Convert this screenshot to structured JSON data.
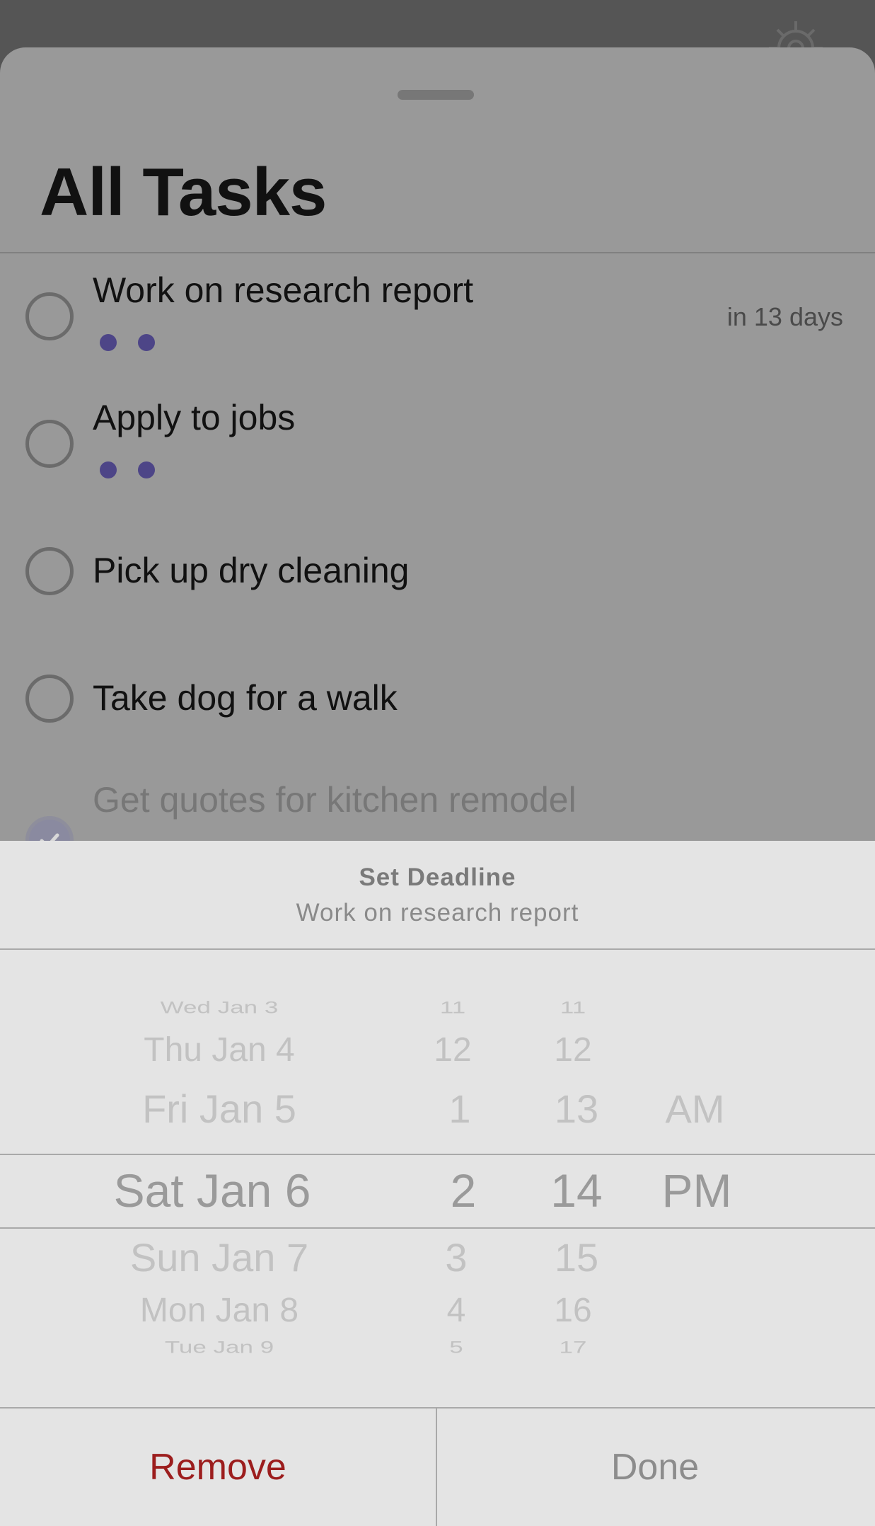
{
  "sheet": {
    "title": "All Tasks"
  },
  "tasks": [
    {
      "label": "Work on research report",
      "due": "in 13 days",
      "dots": 2,
      "completed": false
    },
    {
      "label": "Apply to jobs",
      "due": "",
      "dots": 2,
      "completed": false
    },
    {
      "label": "Pick up dry cleaning",
      "due": "",
      "dots": 0,
      "completed": false
    },
    {
      "label": "Take dog for a walk",
      "due": "",
      "dots": 0,
      "completed": false
    },
    {
      "label": "Get quotes for kitchen remodel",
      "due": "",
      "dots": 0,
      "completed": true
    }
  ],
  "picker": {
    "title": "Set Deadline",
    "subtitle": "Work on research report",
    "dates": [
      "Wed Jan 3",
      "Thu Jan 4",
      "Fri Jan 5",
      "Sat Jan 6",
      "Sun Jan 7",
      "Mon Jan 8",
      "Tue Jan 9"
    ],
    "hours": [
      "11",
      "12",
      "1",
      "2",
      "3",
      "4",
      "5"
    ],
    "minutes": [
      "11",
      "12",
      "13",
      "14",
      "15",
      "16",
      "17"
    ],
    "ampm": [
      "AM",
      "PM"
    ],
    "selected": {
      "date": "Sat Jan 6",
      "hour": "2",
      "minute": "14",
      "ampm": "PM"
    }
  },
  "buttons": {
    "remove": "Remove",
    "done": "Done"
  },
  "colors": {
    "dot": "#4d4587",
    "remove": "#9c1d1d"
  },
  "icons": {
    "settings": "gear-icon",
    "complete": "checkmark-icon"
  }
}
